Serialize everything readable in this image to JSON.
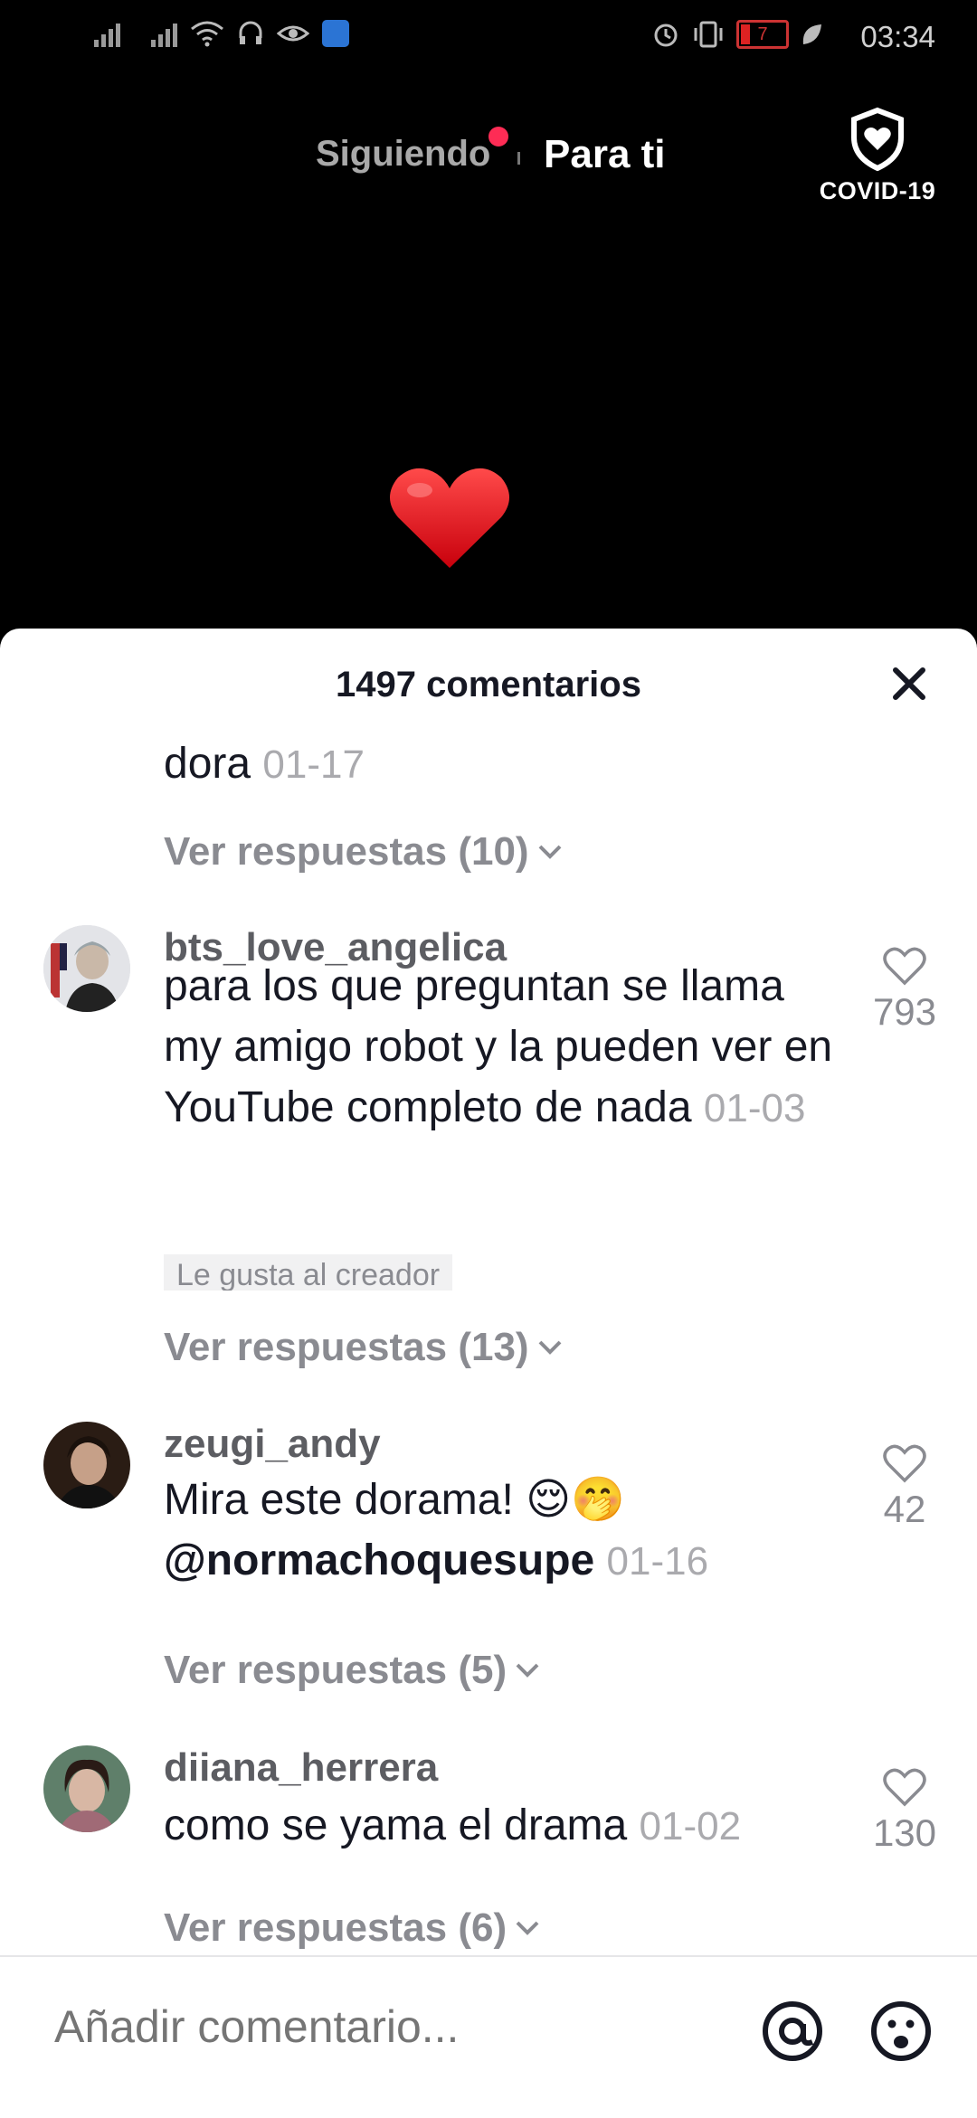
{
  "status_bar": {
    "time": "03:34",
    "battery": "7"
  },
  "top_nav": {
    "following": "Siguiendo",
    "for_you": "Para ti",
    "covid_label": "COVID-19"
  },
  "sheet": {
    "title": "1497 comentarios",
    "prev_tail": {
      "text": "dora",
      "date": "01-17",
      "replies": "Ver respuestas (10)"
    },
    "comments": [
      {
        "username": "bts_love_angelica",
        "text": "para los que preguntan se llama my amigo robot y la pueden ver en YouTube completo de nada",
        "date": "01-03",
        "badge": "Le gusta al creador",
        "likes": "793",
        "replies": "Ver respuestas (13)"
      },
      {
        "username": "zeugi_andy",
        "text": "Mira este dorama! 😌🤭",
        "mention": "@normachoquesupe",
        "date": "01-16",
        "likes": "42",
        "replies": "Ver respuestas (5)"
      },
      {
        "username": "diiana_herrera",
        "text": "como se yama el drama",
        "date": "01-02",
        "likes": "130",
        "replies": "Ver respuestas (6)"
      }
    ]
  },
  "input": {
    "placeholder": "Añadir comentario..."
  },
  "colors": {
    "accent": "#fe2c55",
    "text": "#161823",
    "muted": "#8a8b91"
  }
}
